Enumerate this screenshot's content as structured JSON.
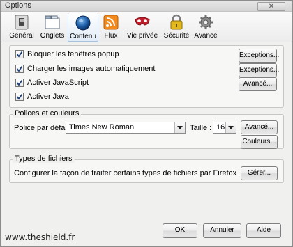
{
  "window": {
    "title": "Options",
    "close_label": "✕"
  },
  "panes": [
    {
      "label": "Général",
      "icon": "general-switch-icon",
      "selected": false
    },
    {
      "label": "Onglets",
      "icon": "tabs-icon",
      "selected": false
    },
    {
      "label": "Contenu",
      "icon": "globe-icon",
      "selected": true
    },
    {
      "label": "Flux",
      "icon": "rss-feed-icon",
      "selected": false
    },
    {
      "label": "Vie privée",
      "icon": "privacy-mask-icon",
      "selected": false
    },
    {
      "label": "Sécurité",
      "icon": "padlock-icon",
      "selected": false
    },
    {
      "label": "Avancé",
      "icon": "gear-icon",
      "selected": false
    }
  ],
  "content": {
    "options": [
      {
        "label": "Bloquer les fenêtres popup",
        "checked": true,
        "button": "Exceptions..."
      },
      {
        "label": "Charger les images automatiquement",
        "checked": true,
        "button": "Exceptions..."
      },
      {
        "label": "Activer JavaScript",
        "checked": true,
        "button": "Avancé..."
      },
      {
        "label": "Activer Java",
        "checked": true,
        "button": ""
      }
    ]
  },
  "fonts": {
    "caption": "Polices et couleurs",
    "default_font_label": "Police par défaut :",
    "default_font_value": "Times New Roman",
    "size_label": "Taille :",
    "size_value": "16",
    "advanced_button": "Avancé...",
    "colors_button": "Couleurs..."
  },
  "filetypes": {
    "caption": "Types de fichiers",
    "description": "Configurer la façon de traiter certains types de fichiers par Firefox",
    "manage_button": "Gérer..."
  },
  "footer": {
    "ok_button": "OK",
    "cancel_button": "Annuler",
    "help_button": "Aide",
    "watermark": "www.theshield.fr"
  }
}
